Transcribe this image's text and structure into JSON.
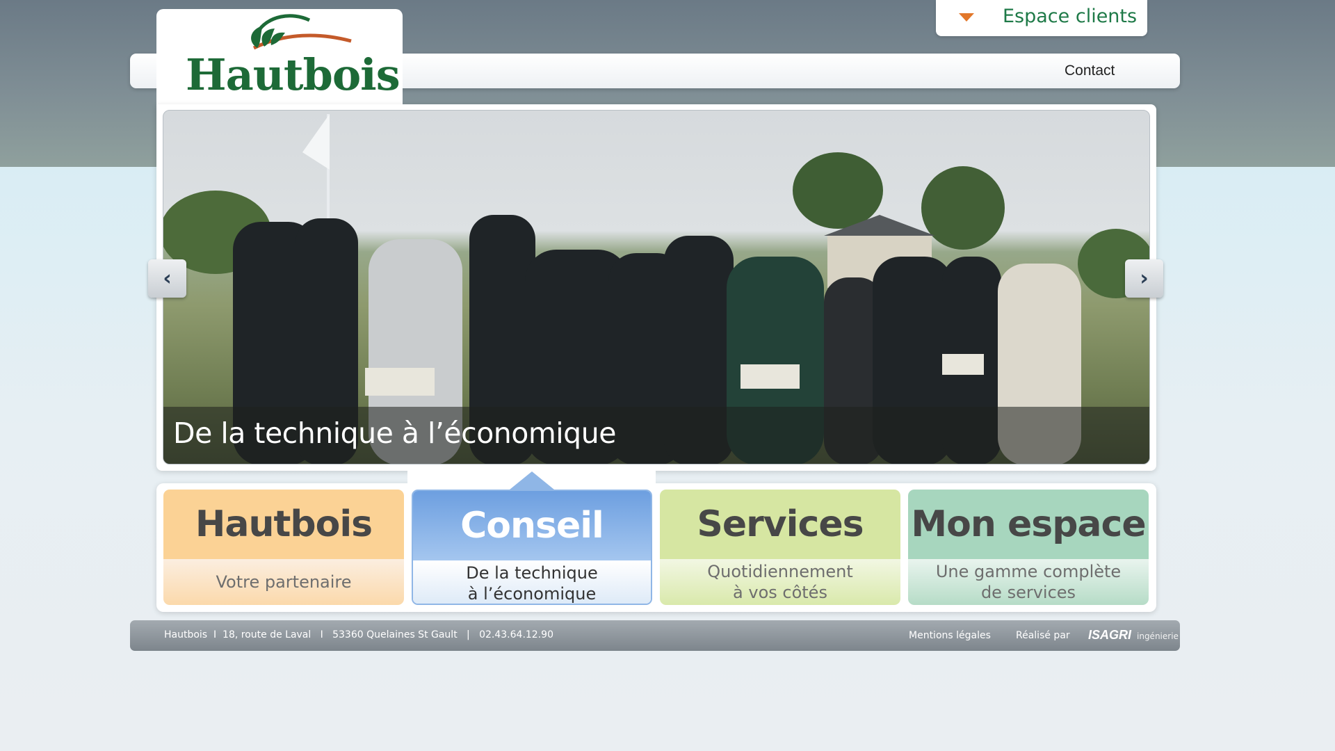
{
  "header": {
    "espace_clients_label": "Espace clients",
    "contact_label": "Contact",
    "logo_text": "Hautbois"
  },
  "slider": {
    "caption": "De la technique à l’économique",
    "prev_icon": "chevron-left-icon",
    "next_icon": "chevron-right-icon"
  },
  "tiles": [
    {
      "title": "Hautbois",
      "subtitle": "Votre partenaire",
      "color": "#fbd295"
    },
    {
      "title": "Conseil",
      "subtitle": "De la technique\nà l’économique",
      "color": "#7aa6e3"
    },
    {
      "title": "Services",
      "subtitle": "Quotidiennement\nà vos côtés",
      "color": "#d6e6a2"
    },
    {
      "title": "Mon espace",
      "subtitle": "Une gamme complète\nde services",
      "color": "#a7d6be"
    }
  ],
  "footer": {
    "address": "Hautbois  I  18, route de Laval   I   53360 Quelaines St Gault   |   02.43.64.12.90",
    "mentions": "Mentions légales",
    "realise_par": "Réalisé par",
    "isagri": "ISAGRI",
    "ingenierie": "ingénierie"
  },
  "colors": {
    "brand_green": "#1d6a37",
    "accent_orange": "#e2772a"
  }
}
